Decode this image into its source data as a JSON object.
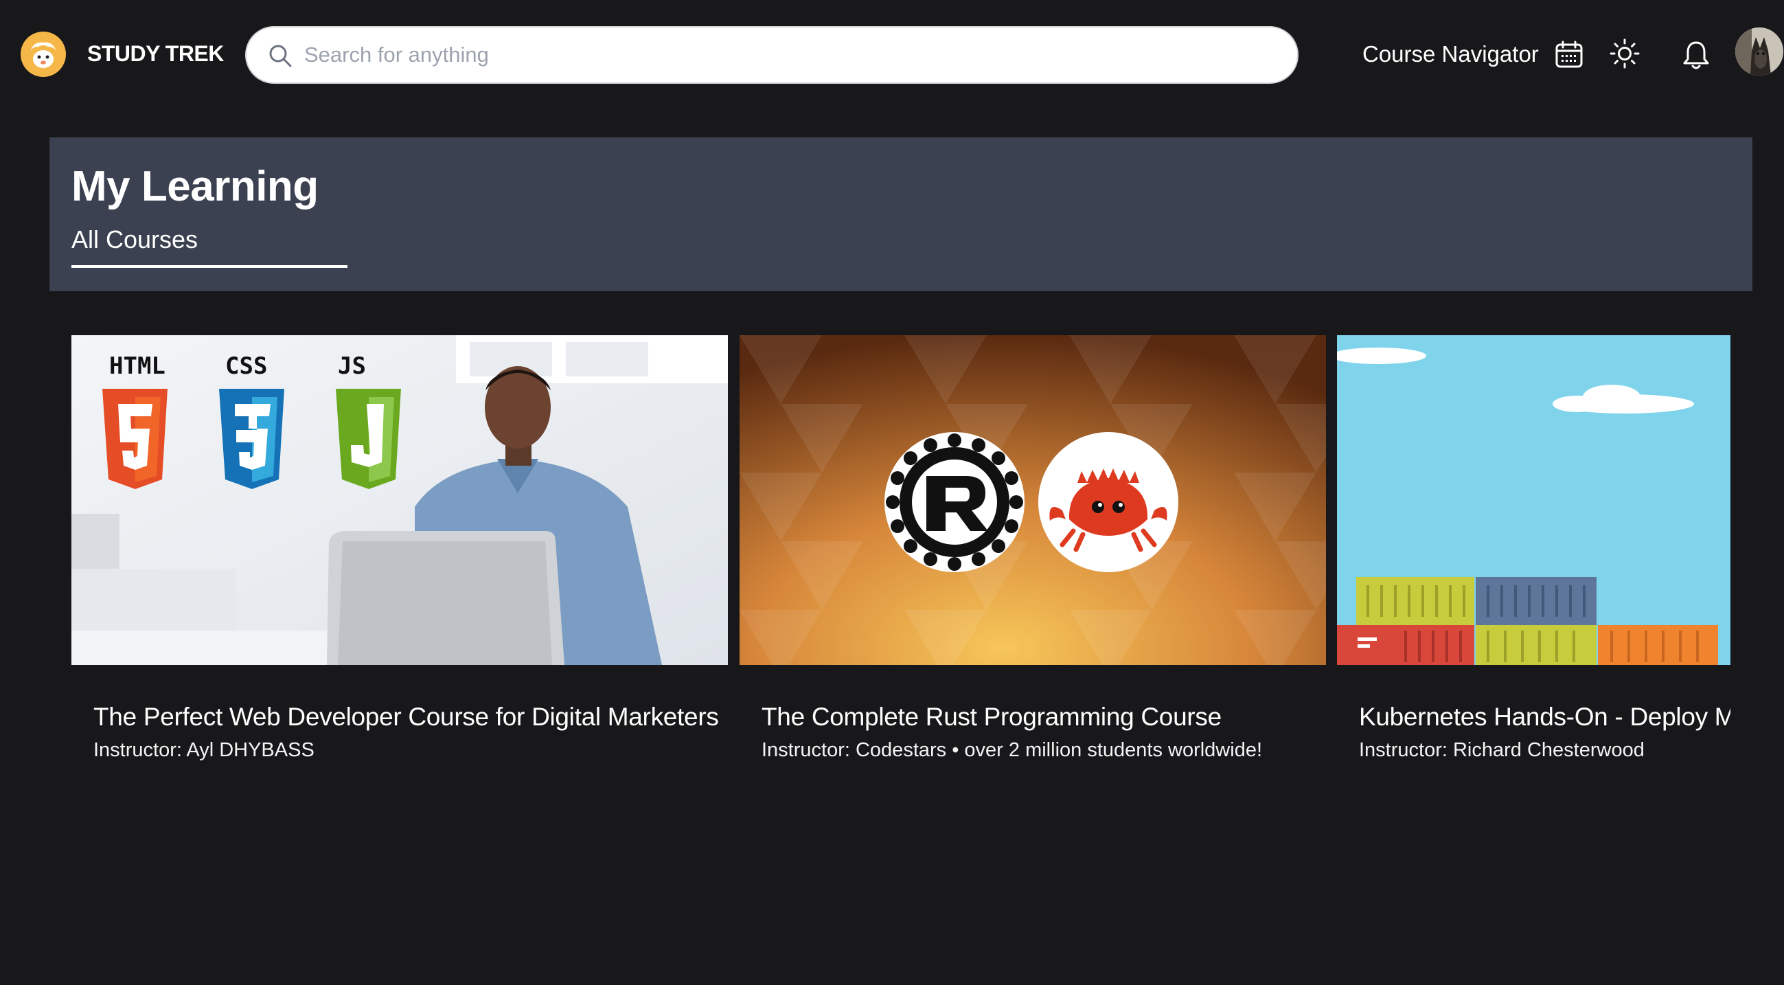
{
  "header": {
    "brand": "STUDY TREK",
    "search_placeholder": "Search for anything",
    "search_value": "",
    "nav_link": "Course Navigator",
    "icons": [
      "calendar-icon",
      "sun-icon",
      "bell-icon"
    ]
  },
  "banner": {
    "title": "My Learning",
    "active_tab": "All Courses"
  },
  "courses": [
    {
      "title": "The Perfect Web Developer Course for Digital Marketers",
      "instructor": "Instructor: Ayl DHYBASS",
      "thumb_labels": [
        "HTML",
        "CSS",
        "JS"
      ]
    },
    {
      "title": "The Complete Rust Programming Course",
      "instructor": "Instructor: Codestars • over 2 million students worldwide!"
    },
    {
      "title": "Kubernetes Hands-On - Deploy Mi",
      "instructor": "Instructor: Richard Chesterwood"
    }
  ],
  "colors": {
    "background": "#18181b",
    "banner": "#3b4150",
    "logo": "#f5b848"
  }
}
